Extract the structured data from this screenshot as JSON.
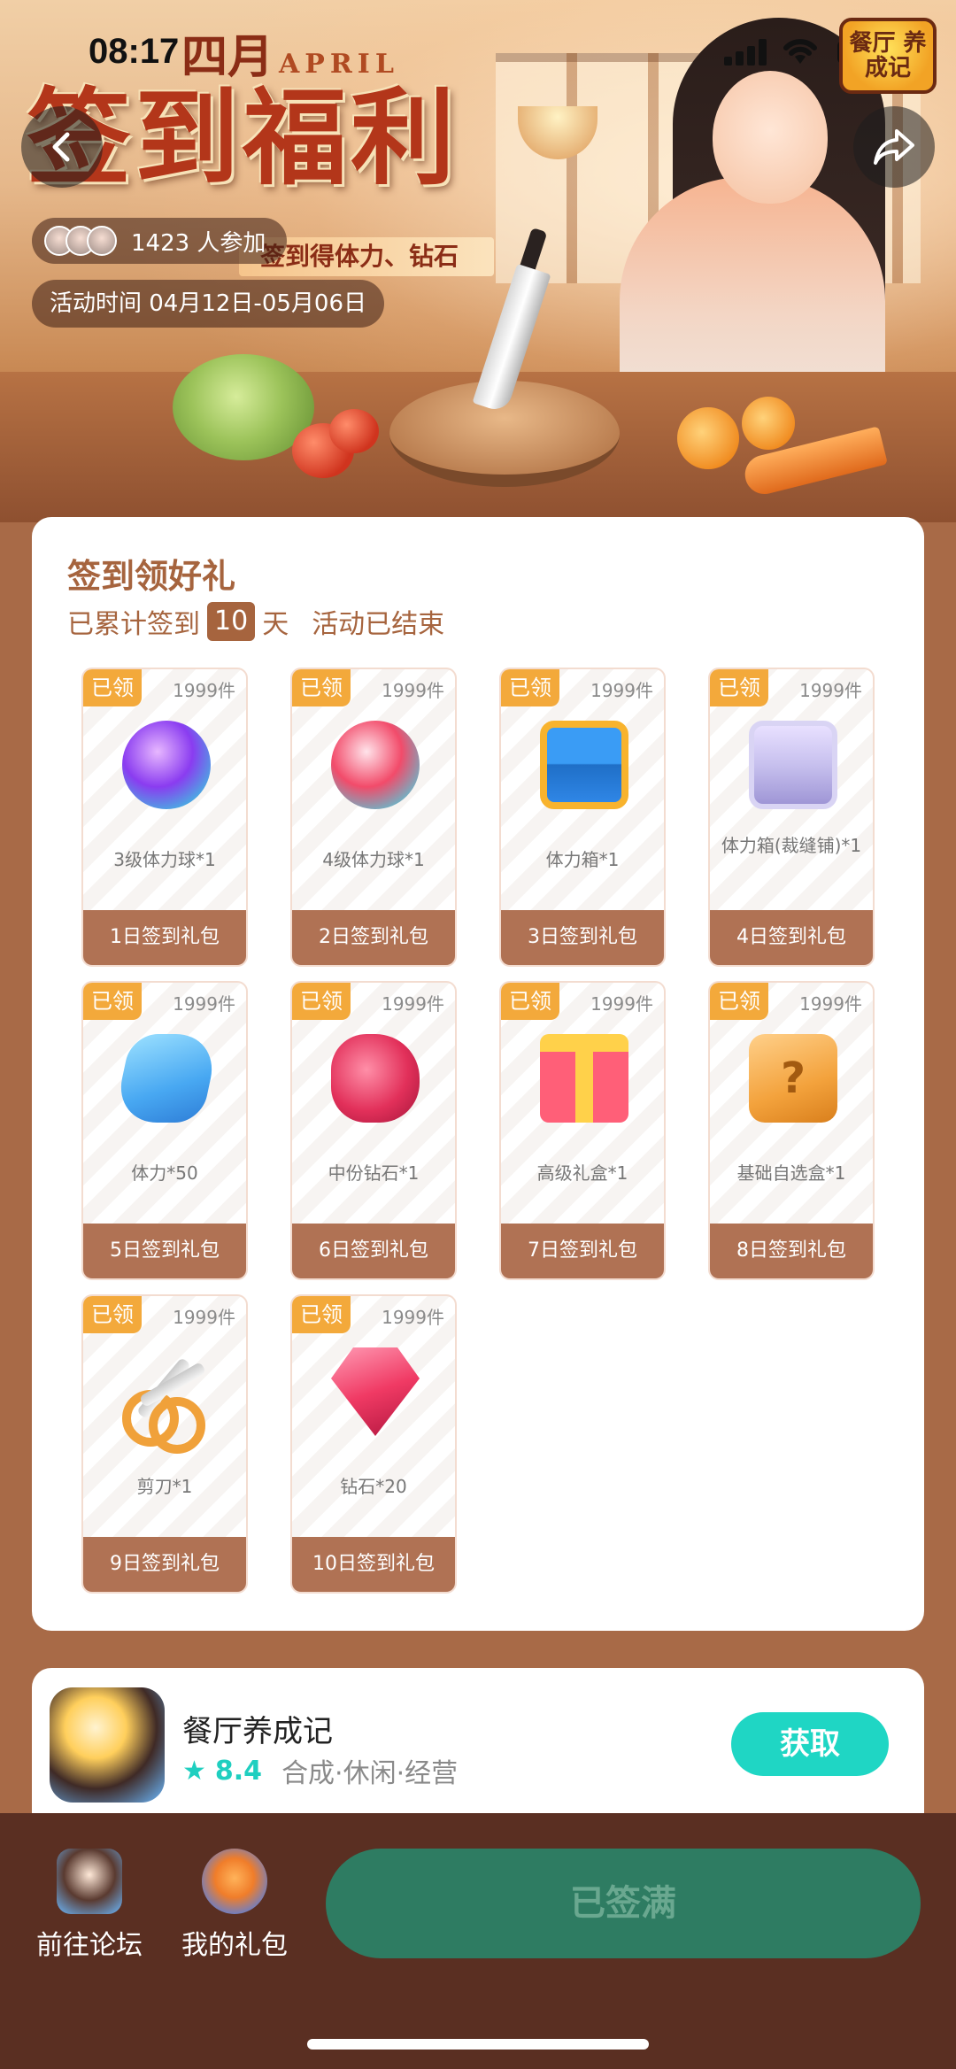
{
  "status_bar": {
    "time": "08:17"
  },
  "banner": {
    "month_cn": "四月",
    "month_en": "APRIL",
    "title": "签到福利",
    "subtitle": "签到得体力、钻石",
    "game_logo": "餐厅 养成记",
    "participants_count": "1423 人参加",
    "activity_time": "活动时间 04月12日-05月06日"
  },
  "card": {
    "title": "签到领好礼",
    "signed_prefix": "已累计签到",
    "signed_days": "10",
    "signed_suffix": "天",
    "status": "活动已结束",
    "gifts": [
      {
        "tag": "已领",
        "stock": "1999件",
        "icon": "stamina-orb-lv3-icon",
        "name": "3级体力球*1",
        "day": "1日签到礼包"
      },
      {
        "tag": "已领",
        "stock": "1999件",
        "icon": "stamina-orb-lv4-icon",
        "name": "4级体力球*1",
        "day": "2日签到礼包"
      },
      {
        "tag": "已领",
        "stock": "1999件",
        "icon": "stamina-chest-icon",
        "name": "体力箱*1",
        "day": "3日签到礼包"
      },
      {
        "tag": "已领",
        "stock": "1999件",
        "icon": "tailor-chest-icon",
        "name": "体力箱(裁缝铺)*1",
        "day": "4日签到礼包"
      },
      {
        "tag": "已领",
        "stock": "1999件",
        "icon": "stamina-bolt-icon",
        "name": "体力*50",
        "day": "5日签到礼包"
      },
      {
        "tag": "已领",
        "stock": "1999件",
        "icon": "gems-icon",
        "name": "中份钻石*1",
        "day": "6日签到礼包"
      },
      {
        "tag": "已领",
        "stock": "1999件",
        "icon": "gift-box-icon",
        "name": "高级礼盒*1",
        "day": "7日签到礼包"
      },
      {
        "tag": "已领",
        "stock": "1999件",
        "icon": "mystery-box-icon",
        "name": "基础自选盒*1",
        "day": "8日签到礼包"
      },
      {
        "tag": "已领",
        "stock": "1999件",
        "icon": "scissors-icon",
        "name": "剪刀*1",
        "day": "9日签到礼包"
      },
      {
        "tag": "已领",
        "stock": "1999件",
        "icon": "diamond-icon",
        "name": "钻石*20",
        "day": "10日签到礼包"
      }
    ]
  },
  "app": {
    "name": "餐厅养成记",
    "rating": "8.4",
    "tags": "合成·休闲·经营",
    "get_label": "获取"
  },
  "bottom_bar": {
    "forum_label": "前往论坛",
    "gifts_label": "我的礼包",
    "signed_label": "已签满"
  },
  "colors": {
    "accent_brown": "#a6643e",
    "tag_orange": "#f3a93b",
    "get_button": "#1fd6c4",
    "signed_button": "#2e7c62",
    "bottom_bar": "#5a2f22"
  }
}
